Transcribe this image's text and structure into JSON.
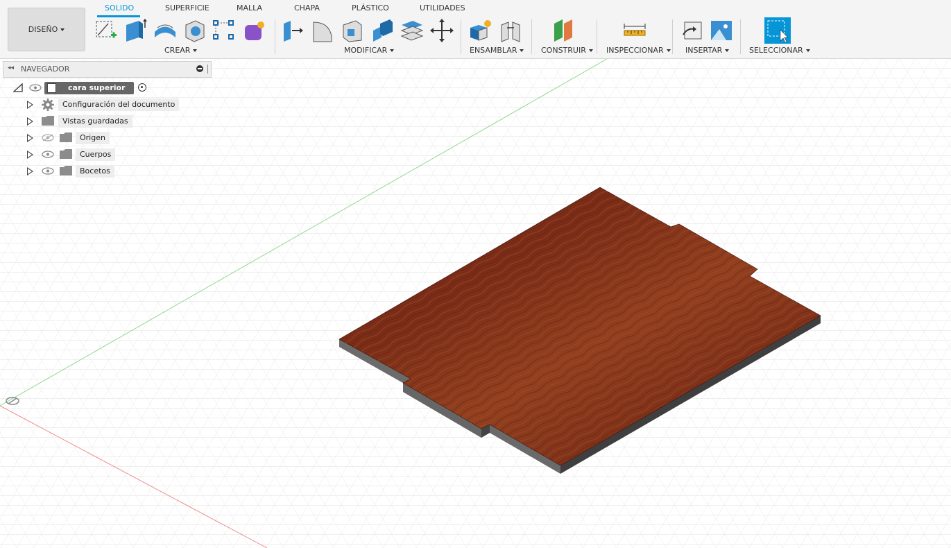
{
  "workspace": {
    "label": "DISEÑO"
  },
  "tabs": [
    {
      "label": "SOLIDO",
      "active": true
    },
    {
      "label": "SUPERFICIE"
    },
    {
      "label": "MALLA"
    },
    {
      "label": "CHAPA"
    },
    {
      "label": "PLÁSTICO"
    },
    {
      "label": "UTILIDADES"
    }
  ],
  "groups": {
    "crear": "CREAR",
    "modificar": "MODIFICAR",
    "ensamblar": "ENSAMBLAR",
    "construir": "CONSTRUIR",
    "inspeccionar": "INSPECCIONAR",
    "insertar": "INSERTAR",
    "seleccionar": "SELECCIONAR"
  },
  "navigator": {
    "title": "NAVEGADOR",
    "root": "cara superior v1",
    "items": [
      {
        "label": "Configuración del documento",
        "icon": "gear-icon"
      },
      {
        "label": "Vistas guardadas",
        "icon": "folder-icon"
      },
      {
        "label": "Origen",
        "icon": "folder-icon",
        "visibility": "hidden"
      },
      {
        "label": "Cuerpos",
        "icon": "folder-icon",
        "visibility": "visible"
      },
      {
        "label": "Bocetos",
        "icon": "folder-icon",
        "visibility": "visible"
      }
    ]
  },
  "colors": {
    "accent": "#0696d7",
    "wood": "#7e2e18",
    "edge": "#6b6b6b",
    "grid": "#e3e3e3"
  }
}
